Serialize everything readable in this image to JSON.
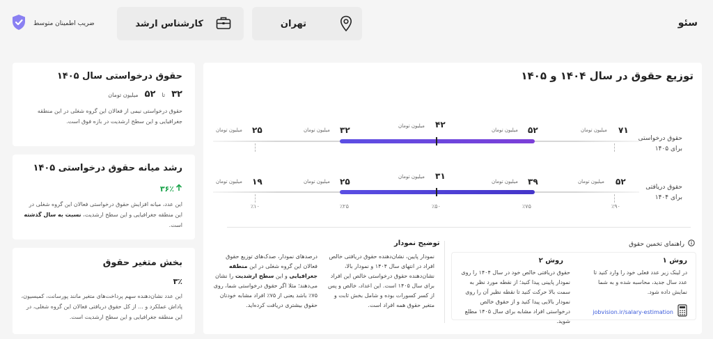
{
  "header": {
    "job_title": "سئو",
    "city": "تهران",
    "level": "کارشناس ارشد",
    "trust_label": "ضریب اطمینان متوسط"
  },
  "colors": {
    "accent": "#5b4ee3",
    "green": "#1aa34a",
    "shield": "#7a6ff0"
  },
  "cards": {
    "salary": {
      "title": "حقوق درخواستی سال ۱۴۰۵",
      "max": "۵۲",
      "to": "تا",
      "min": "۳۲",
      "unit": "میلیون تومان",
      "desc": "حقوق درخواستی نیمی از فعالان این گروه شغلی در این منطقه جغرافیایی و این سطح ارشدیت در بازه فوق است."
    },
    "growth": {
      "title": "رشد میانه حقوق درخواستی ۱۴۰۵",
      "value": "۳۶٪",
      "desc_a": "این عدد، میانه افزایش حقوق درخواستی فعالان این گروه شغلی در این منطقه جغرافیایی و این سطح ارشدیت،",
      "desc_b": "نسبت به سال گذشته",
      "desc_c": "است."
    },
    "variable": {
      "title": "بخش متغیر حقوق",
      "value": "۳٪",
      "desc": "این عدد نشان‌دهنده سهم پرداخت‌های متغیر مانند پورسانت، کمیسیون، پاداش عملکرد و ... از کل حقوق دریافتی فعالان این گروه شغلی، در این منطقه جغرافیایی و این سطح ارشدیت است."
    }
  },
  "distribution": {
    "title": "توزیع حقوق در سال ۱۴۰۴ و ۱۴۰۵",
    "unit": "میلیون تومان",
    "row1": {
      "label_a": "حقوق درخواستی",
      "label_b": "برای ۱۴۰۵",
      "p10": "۲۵",
      "p25": "۳۲",
      "p50": "۴۲",
      "p75": "۵۲",
      "p90": "۷۱"
    },
    "row2": {
      "label_a": "حقوق دریافتی",
      "label_b": "برای ۱۴۰۴",
      "p10": "۱۹",
      "p25": "۲۵",
      "p50": "۳۱",
      "p75": "۳۹",
      "p90": "۵۲"
    },
    "percentiles": [
      "٪۱۰",
      "٪۲۵",
      "٪۵۰",
      "٪۷۵",
      "٪۹۰"
    ]
  },
  "guide": {
    "title": "راهنمای تخمین حقوق",
    "m1_title": "روش ۱",
    "m1_text": "در لینک زیر عدد فعلی خود را وارد کنید تا عدد سال جدید، محاسبه شده و به شما نمایش داده شود.",
    "m1_link": "jobvision.ir/salary-estimation",
    "m2_title": "روش ۲",
    "m2_text": "حقوق دریافتی خالص خود در سال ۱۴۰۴ را روی نمودار پایینی پیدا کنید؛ از نقطه مورد نظر به سمت بالا حرکت کنید تا نقطه نظیر آن را روی نمودار بالایی پیدا کنید و از حقوق خالص درخواستی افراد مشابه برای سال ۱۴۰۵ مطلع شوید."
  },
  "explain": {
    "title": "توضیح نمودار",
    "col1": "نمودار پایین، نشان‌دهنده حقوق دریافتی خالص افراد در انتهای سال ۱۴۰۴ و نمودار بالا، نشان‌دهنده حقوق درخواستی خالص این افراد برای سال ۱۴۰۵ است. این اعداد، خالص و پس از کسر کسورات بوده و شامل بخش ثابت و متغیر حقوق همه افراد است.",
    "col2_a": "درصدهای نمودار، صدک‌های توزیع حقوق فعالان این گروه شغلی در این",
    "col2_b": "منطقه جغرافیایی",
    "col2_c": "و این",
    "col2_d": "سطح ارشدیت",
    "col2_e": "را نشان می‌دهند؛ مثلا اگر حقوق درخواستی شما، روی ۷۵٪ باشد یعنی از ۷۵٪ افراد مشابه خودتان حقوق بیشتری دریافت کرده‌اید."
  }
}
